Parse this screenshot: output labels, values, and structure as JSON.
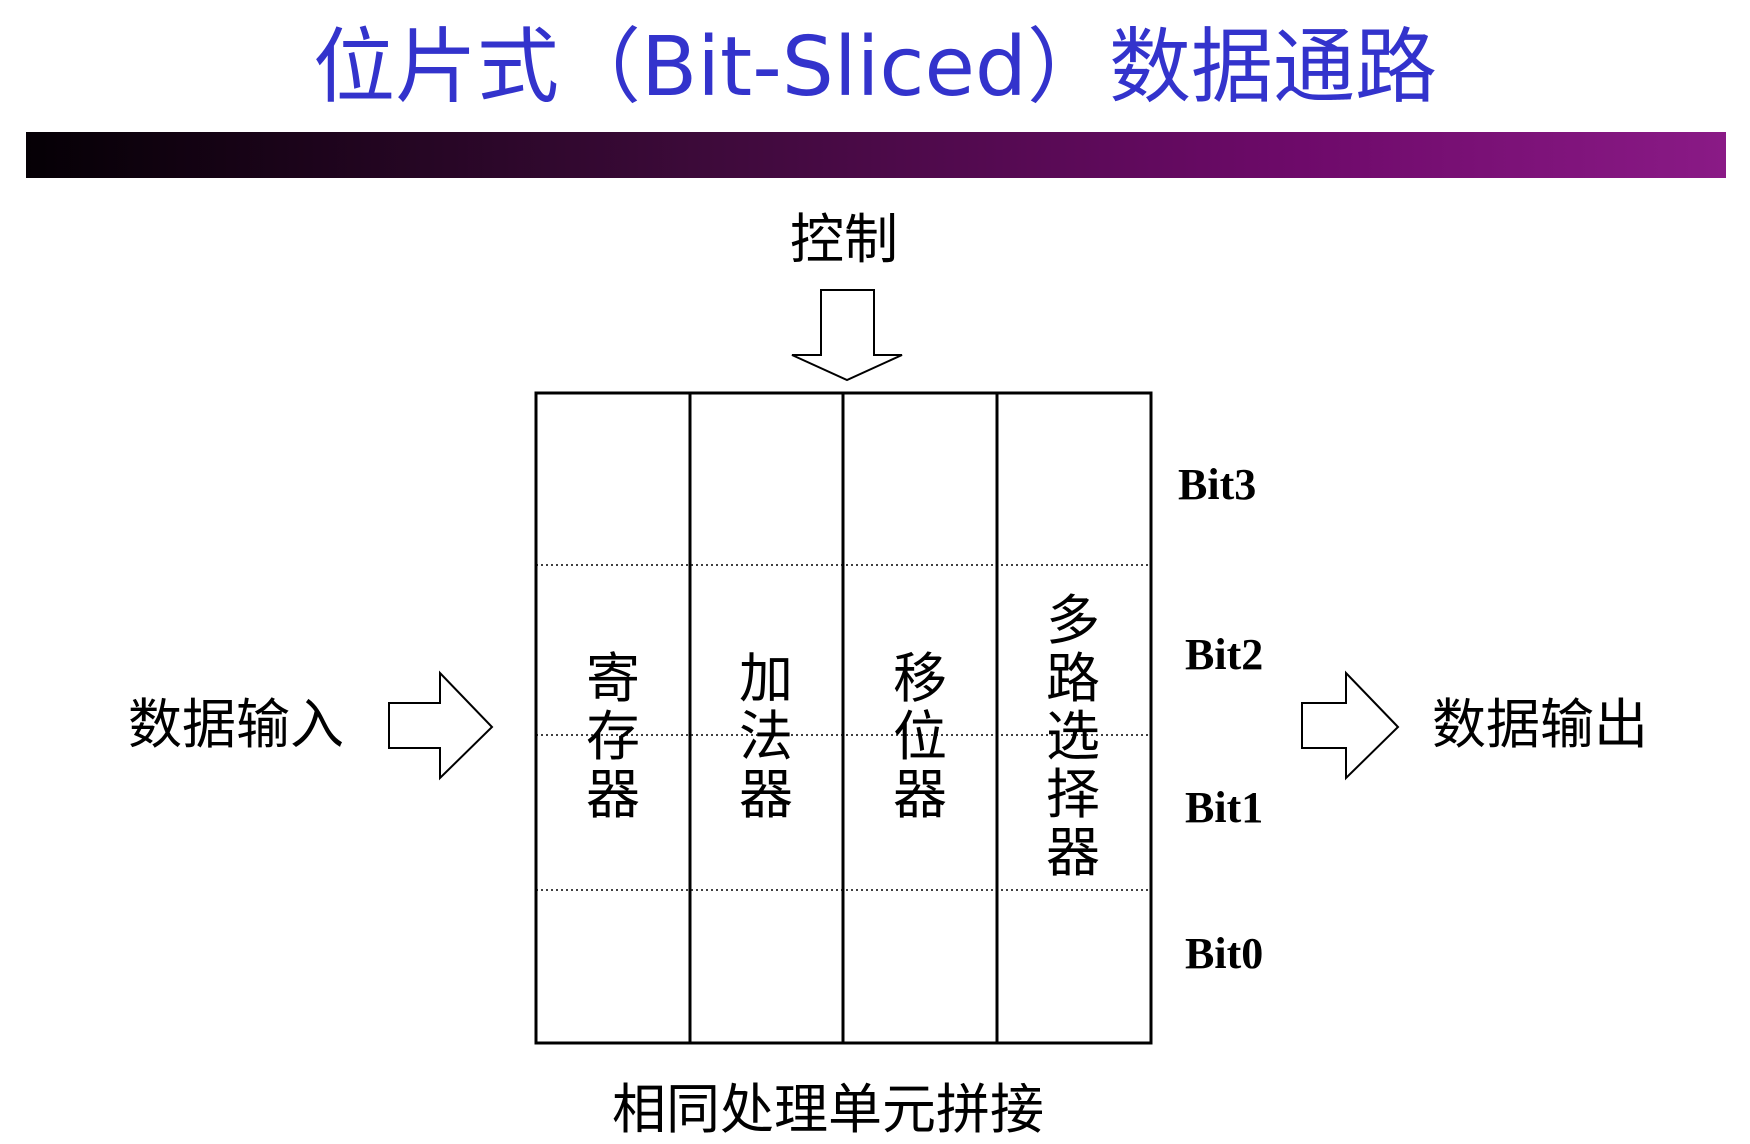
{
  "title": "位片式（Bit-Sliced）数据通路",
  "control_label": "控制",
  "input_label": "数据输入",
  "output_label": "数据输出",
  "caption": "相同处理单元拼接",
  "units": [
    {
      "label": "寄存器"
    },
    {
      "label": "加法器"
    },
    {
      "label": "移位器"
    },
    {
      "label": "多路选择器"
    }
  ],
  "bits": {
    "bit3": "Bit3",
    "bit2": "Bit2",
    "bit1": "Bit1",
    "bit0": "Bit0"
  },
  "colors": {
    "title": "#3333cc",
    "bar_start": "#050005",
    "bar_end": "#8a1a86"
  }
}
